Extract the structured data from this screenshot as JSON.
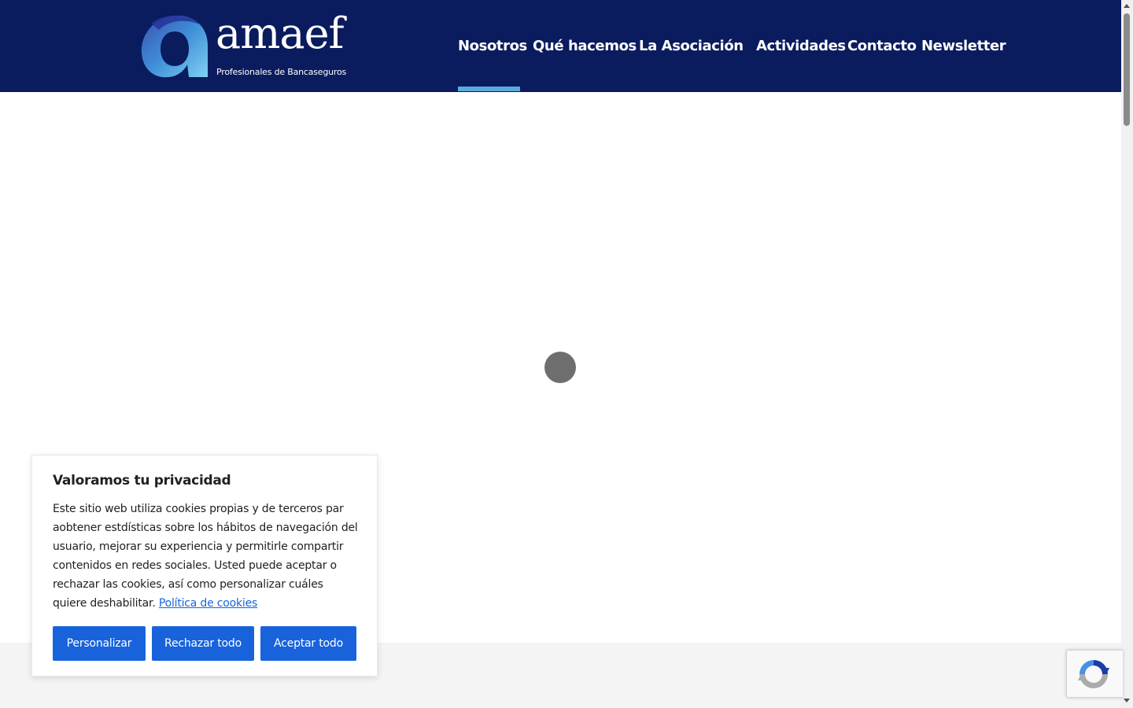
{
  "brand": {
    "name": "amaef",
    "tagline": "Profesionales de Bancaseguros",
    "header_color": "#0a1c5e",
    "accent_color": "#5aa9df"
  },
  "nav": {
    "items": [
      {
        "label": "Nosotros",
        "active": true
      },
      {
        "label": "Qué hacemos",
        "active": false
      },
      {
        "label": "La Asociación",
        "active": false
      },
      {
        "label": "Actividades",
        "active": false
      },
      {
        "label": "Contacto",
        "active": false
      },
      {
        "label": "Newsletter",
        "active": false
      }
    ]
  },
  "main": {
    "loader_icon": "spinner-icon"
  },
  "cookie_banner": {
    "title": "Valoramos tu privacidad",
    "body": "Este sitio web utiliza cookies propias y de terceros par aobtener estdísticas sobre los hábitos de navegación del usuario, mejorar su experiencia y permitirle compartir contenidos en redes sociales. Usted puede aceptar o rechazar las cookies, así como personalizar cuáles quiere deshabilitar.",
    "policy_link": "Política de cookies",
    "buttons": {
      "customize": "Personalizar",
      "reject": "Rechazar todo",
      "accept": "Aceptar todo"
    },
    "button_color": "#1863dc"
  },
  "recaptcha": {
    "icon": "recaptcha-icon"
  }
}
